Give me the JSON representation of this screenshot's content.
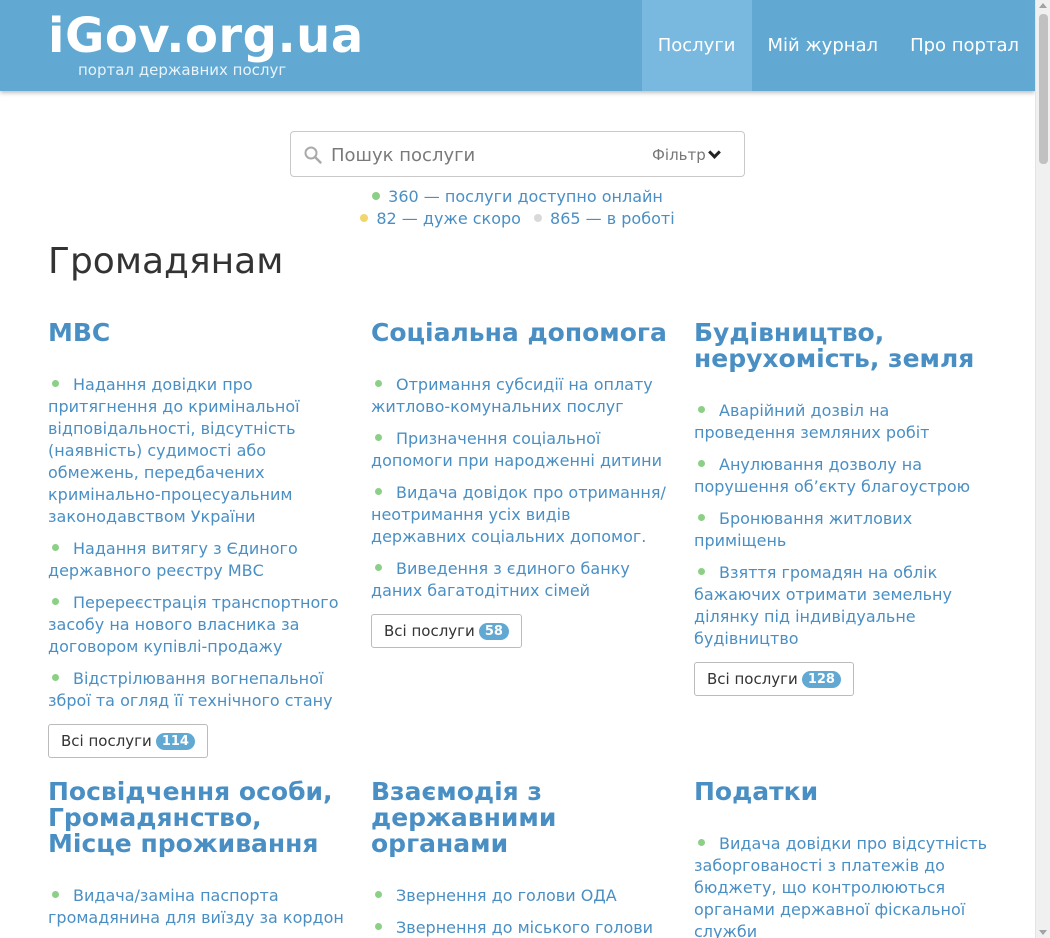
{
  "header": {
    "logo": "iGov.org.ua",
    "tagline": "портал державних послуг",
    "nav": [
      "Послуги",
      "Мій журнал",
      "Про портал"
    ]
  },
  "search": {
    "placeholder": "Пошук послуги",
    "filter_label": "Фільтр"
  },
  "stats": {
    "online": "360 — послуги доступно онлайн",
    "soon": "82 — дуже скоро",
    "in_progress": "865 — в роботі"
  },
  "colors": {
    "header": "#61a8d2",
    "link": "#4a8fc4",
    "online_dot": "#8ccf86",
    "soon_dot": "#f2d56b",
    "progress_dot": "#d9d9d9"
  },
  "page_title": "Громадянам",
  "sections": [
    {
      "title": "МВС",
      "items": [
        "Надання довідки про притягнення до кримінальної відповідальності, відсутність (наявність) судимості або обмежень, передбачених кримінально-процесуальним законодавством України",
        "Надання витягу з Єдиного державного реєстру МВС",
        "Перереєстрація транспортного засобу на нового власника за договором купівлі-продажу",
        "Відстрілювання вогнепальної зброї та огляд її технічного стану"
      ],
      "all_label": "Всі послуги",
      "count": "114"
    },
    {
      "title": "Соціальна допомога",
      "items": [
        "Отримання субсидії на оплату житлово-комунальних послуг",
        "Призначення соціальної допомоги при народженні дитини",
        "Видача довідок про отримання/неотримання усіх видів державних соціальних допомог.",
        "Виведення з єдиного банку даних багатодітних сімей"
      ],
      "all_label": "Всі послуги",
      "count": "58"
    },
    {
      "title": "Будівництво, нерухомість, земля",
      "items": [
        "Аварійний дозвіл на проведення земляних робіт",
        "Анулювання дозволу на порушення об’єкту благоустрою",
        "Бронювання житлових приміщень",
        "Взяття громадян на облік бажаючих отримати земельну ділянку під індивідуальне будівництво"
      ],
      "all_label": "Всі послуги",
      "count": "128"
    },
    {
      "title": "Посвідчення особи, Громадянство, Місце проживання",
      "items": [
        "Видача/заміна паспорта громадянина для виїзду за кордон"
      ]
    },
    {
      "title": "Взаємодія з державними органами",
      "items": [
        "Звернення до голови ОДА",
        "Звернення до міського голови"
      ]
    },
    {
      "title": "Податки",
      "items": [
        "Видача довідки про відсутність заборгованості з платежів до бюджету, що контролюються органами державної фіскальної служби"
      ]
    }
  ]
}
